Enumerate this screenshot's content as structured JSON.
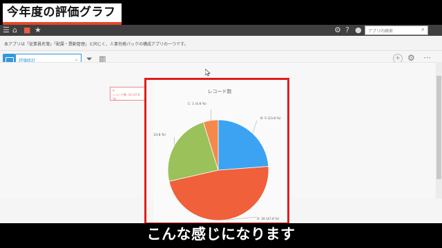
{
  "banner": {
    "title": "今年度の評価グラフ"
  },
  "app": {
    "search_placeholder": "アプリ内検索",
    "description": "本アプリは「従業員名簿」「配属・異動管理」と同じく、人事労務パックの構成アプリの一つです。",
    "view_select": "評価統計",
    "graph_type": "円グラフ"
  },
  "legend": {
    "line1": "A",
    "line2": "レコード数: 10 (47.6 %)"
  },
  "chart_data": {
    "type": "pie",
    "title": "レコード数",
    "categories": [
      "B",
      "A",
      "D",
      "C"
    ],
    "values": [
      5,
      10,
      5,
      1
    ],
    "labels": [
      "B: 5 (23.8 %)",
      "A: 10 (47.6 %)",
      "D: 5 (23.8 %)",
      "C: 1 (4.8 %)"
    ],
    "colors": [
      "#3ba3f1",
      "#f0603a",
      "#9bc15a",
      "#f4894b"
    ]
  },
  "subtitle": "こんな感じになります"
}
